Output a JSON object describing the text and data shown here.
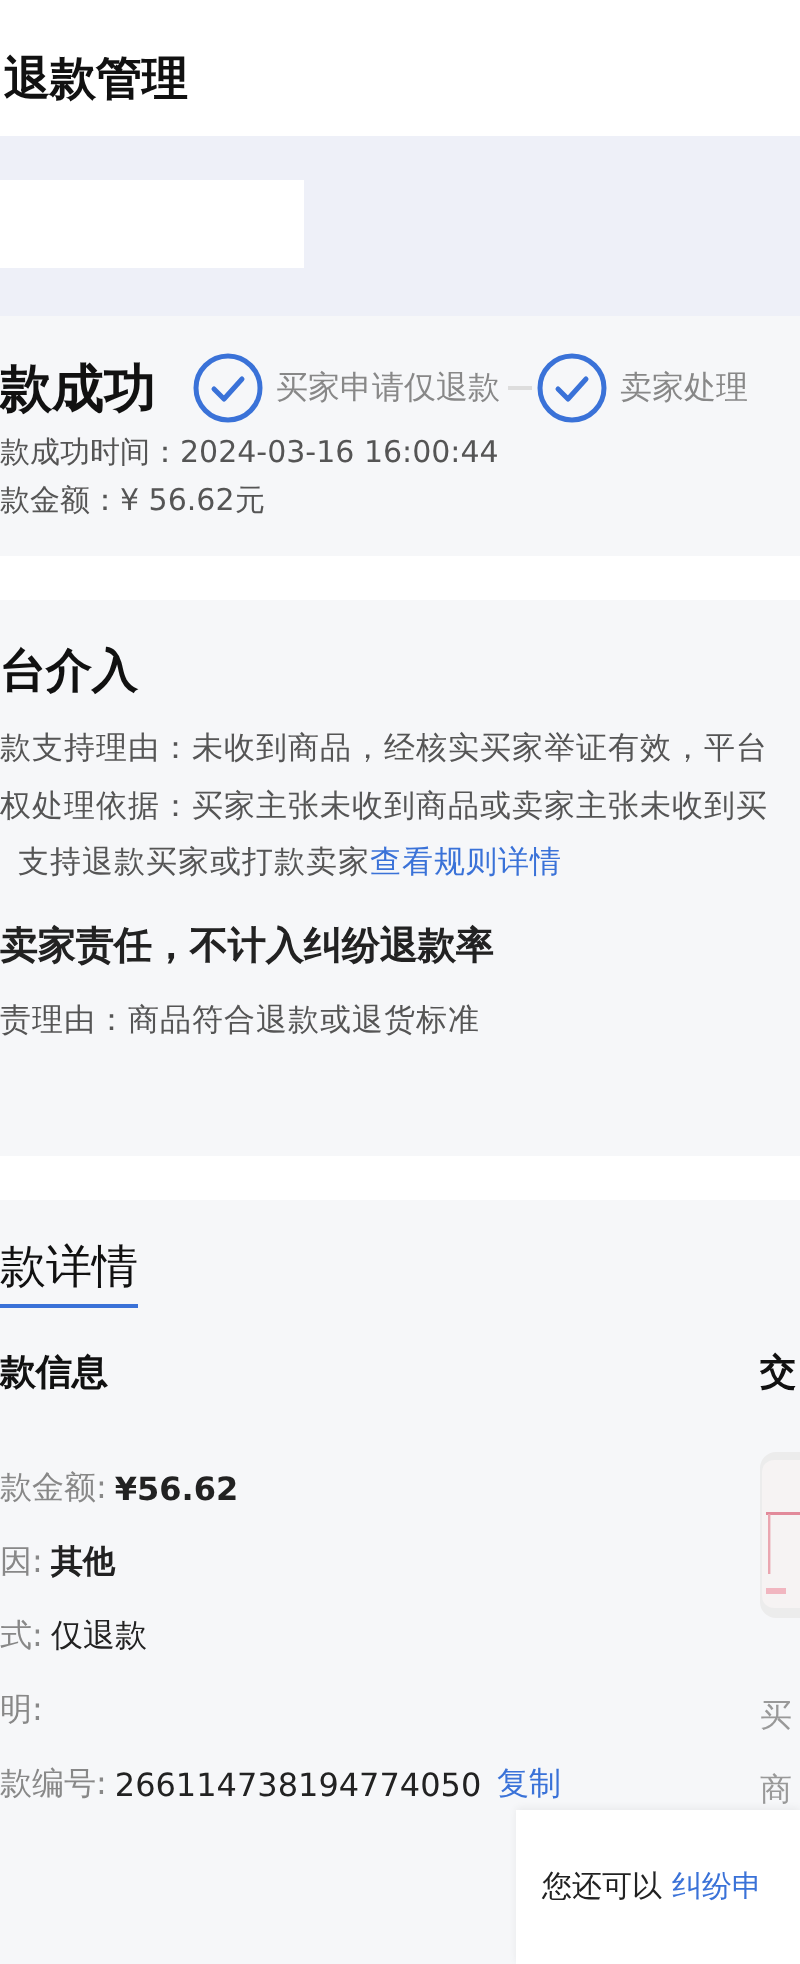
{
  "header": {
    "title": "退款管理"
  },
  "status": {
    "title": "款成功",
    "steps": [
      {
        "label": "买家申请仅退款",
        "done": true
      },
      {
        "label": "卖家处理",
        "done": true
      }
    ],
    "lines": [
      {
        "label": "款成功时间：",
        "value": "2024-03-16 16:00:44"
      },
      {
        "label": "款金额：",
        "value": "¥ 56.62元"
      }
    ]
  },
  "ruling": {
    "title": "台介入",
    "lines": [
      "款支持理由：未收到商品，经核实买家举证有效，平台",
      "权处理依据：买家主张未收到商品或卖家主张未收到买"
    ],
    "continuation": "支持退款买家或打款卖家",
    "link": "查看规则详情",
    "verdict": "卖家责任，不计入纠纷退款率",
    "verdict_reason": "责理由：商品符合退款或退货标准"
  },
  "details": {
    "tab": "款详情",
    "section": "款信息",
    "rows": [
      {
        "label": "款金额:",
        "value": "¥56.62",
        "bold": true
      },
      {
        "label": "因:",
        "value": "其他",
        "bold": true
      },
      {
        "label": "式:",
        "value": "仅退款",
        "bold": false
      },
      {
        "label": "明:"
      },
      {
        "label": "款编号:",
        "value": "266114738194774050",
        "bold": false,
        "action": "复制"
      }
    ],
    "side": {
      "title": "交",
      "labels": [
        "买",
        "商"
      ]
    }
  },
  "popup": {
    "text": "您还可以",
    "link": "纠纷申"
  }
}
